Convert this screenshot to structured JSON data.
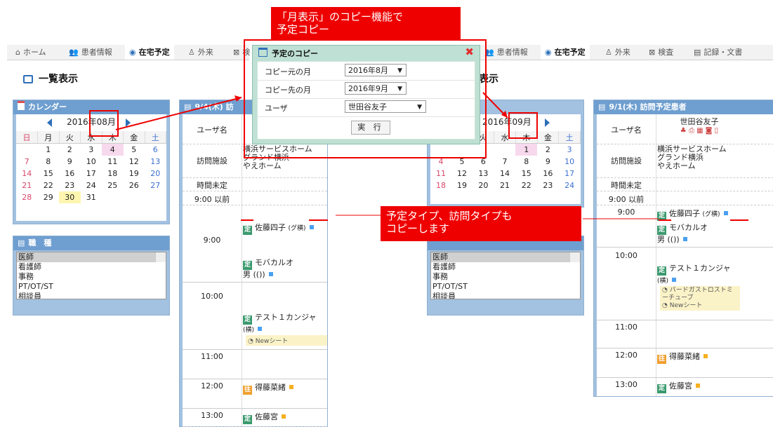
{
  "nav_left": {
    "items": [
      {
        "icon": "home-icon",
        "glyph": "⌂",
        "label": "ホーム"
      },
      {
        "icon": "patient-icon",
        "glyph": "👥",
        "label": "患者情報"
      },
      {
        "icon": "home-schedule-icon",
        "glyph": "◉",
        "label": "在宅予定",
        "active": true
      },
      {
        "icon": "outpatient-icon",
        "glyph": "♙",
        "label": "外来"
      },
      {
        "icon": "exam-icon",
        "glyph": "⊠",
        "label": "検"
      }
    ]
  },
  "nav_right": {
    "items": [
      {
        "icon": "patient-icon",
        "glyph": "👥",
        "label": "患者情報"
      },
      {
        "icon": "home-schedule-icon",
        "glyph": "◉",
        "label": "在宅予定",
        "active": true
      },
      {
        "icon": "outpatient-icon",
        "glyph": "♙",
        "label": "外来"
      },
      {
        "icon": "exam-icon",
        "glyph": "⊠",
        "label": "検査"
      },
      {
        "icon": "record-icon",
        "glyph": "▤",
        "label": "記録・文書"
      }
    ]
  },
  "page_title_left": "一覧表示",
  "page_title_right": "表示",
  "calendar_left": {
    "header": "カレンダー",
    "month": "2016年08月",
    "weekdays": [
      "日",
      "月",
      "火",
      "水",
      "木",
      "金",
      "土"
    ],
    "weeks": [
      [
        "",
        "1",
        "2",
        "3",
        "4",
        "5",
        "6"
      ],
      [
        "7",
        "8",
        "9",
        "10",
        "11",
        "12",
        "13"
      ],
      [
        "14",
        "15",
        "16",
        "17",
        "18",
        "19",
        "20"
      ],
      [
        "21",
        "22",
        "23",
        "24",
        "25",
        "26",
        "27"
      ],
      [
        "28",
        "29",
        "30",
        "31",
        "",
        "",
        ""
      ]
    ]
  },
  "calendar_right": {
    "month": "2016年09月",
    "weekdays": [
      "火",
      "水",
      "木",
      "金",
      "土"
    ],
    "weeks": [
      [
        "",
        "",
        "1",
        "2",
        "3"
      ],
      [
        "6",
        "7",
        "8",
        "9",
        "10"
      ],
      [
        "13",
        "14",
        "15",
        "16",
        "17"
      ],
      [
        "20",
        "21",
        "22",
        "23",
        "24"
      ]
    ],
    "left_col": [
      "",
      "4",
      "11",
      "18"
    ],
    "left_col2": [
      "",
      "5",
      "12",
      "19"
    ]
  },
  "job_type": {
    "header": "職　種",
    "items": [
      "医師",
      "看護師",
      "事務",
      "PT/OT/ST",
      "相談員"
    ]
  },
  "job_type_right": {
    "items": [
      "医師",
      "看護師",
      "事務",
      "PT/OT/ST",
      "相談員"
    ]
  },
  "schedule_left": {
    "header": "9/4(木) 訪",
    "user_label": "ユーザ名",
    "facility_label": "訪問施設",
    "facilities": [
      "横浜サービスホーム",
      "グランド横浜",
      "やえホーム"
    ],
    "undecided_label": "時間未定",
    "before9_label": "9:00 以前",
    "t900": "9:00",
    "t1000": "10:00",
    "t1100": "11:00",
    "t1200": "12:00",
    "t1300": "13:00",
    "e1_badge": "定",
    "e1_name": "佐藤四子",
    "e1_note": "(グ横)",
    "e2_badge": "定",
    "e2_name": "モバカルオ",
    "e2_note": "男 (())",
    "e3_badge": "定",
    "e3_name": "テスト１カンジャ",
    "e3_note": "(横)",
    "e3_sub": "Newシート",
    "e4_badge": "往",
    "e4_name": "得藤菜緒",
    "e5_badge": "定",
    "e5_name": "佐藤宮"
  },
  "schedule_right": {
    "header": "9/1(木) 訪問予定患者",
    "user_label": "ユーザ名",
    "user_name": "世田谷友子",
    "facility_label": "訪問施設",
    "facilities": [
      "横浜サービスホーム",
      "グランド横浜",
      "やえホーム"
    ],
    "undecided_label": "時間未定",
    "before9_label": "9:00 以前",
    "t900": "9:00",
    "t1000": "10:00",
    "t1100": "11:00",
    "t1200": "12:00",
    "t1300": "13:00",
    "e1_badge": "定",
    "e1_name": "佐藤四子",
    "e1_note": "(グ横)",
    "e2_badge": "定",
    "e2_name": "モバカルオ",
    "e2_note": "男 (())",
    "e3_badge": "定",
    "e3_name": "テスト１カンジャ",
    "e3_note": "(横)",
    "e3_sub1": "バードガストロストミーチューブ",
    "e3_sub2": "Newシート",
    "e4_badge": "往",
    "e4_name": "得藤菜緒",
    "e5_badge": "定",
    "e5_name": "佐藤宮"
  },
  "dialog": {
    "title": "予定のコピー",
    "src_label": "コピー元の月",
    "src_value": "2016年8月",
    "dst_label": "コピー先の月",
    "dst_value": "2016年9月",
    "user_label": "ユーザ",
    "user_value": "世田谷友子",
    "exec_label": "実 行"
  },
  "callout_top": "「月表示」のコピー機能で\n予定コピー",
  "callout_mid": "予定タイプ、訪問タイプも\nコピーします",
  "colors": {
    "accent": "#ee0000",
    "panel_blue": "#6f9fd0",
    "dialog_bg": "#bfe0d4"
  }
}
